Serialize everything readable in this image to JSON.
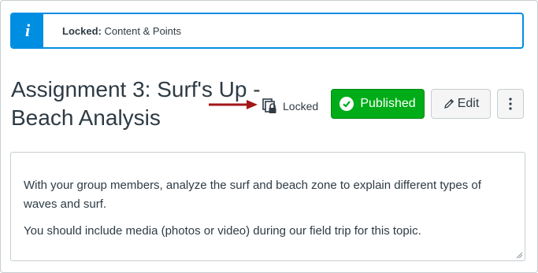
{
  "banner": {
    "icon": "info-icon",
    "icon_glyph": "i",
    "label_strong": "Locked:",
    "label_text": "Content & Points",
    "color": "#008ee2"
  },
  "assignment": {
    "title": "Assignment 3: Surf's Up - Beach Analysis",
    "lock_status": "Locked"
  },
  "toolbar": {
    "published_label": "Published",
    "edit_label": "Edit",
    "published_color": "#00ac18"
  },
  "description": {
    "paragraphs": [
      "With your group members, analyze the surf and beach zone to explain different types of waves and surf.",
      "You should include media (photos or video) during our field trip for this topic."
    ]
  },
  "annotation": {
    "arrow_color": "#a4161a"
  }
}
